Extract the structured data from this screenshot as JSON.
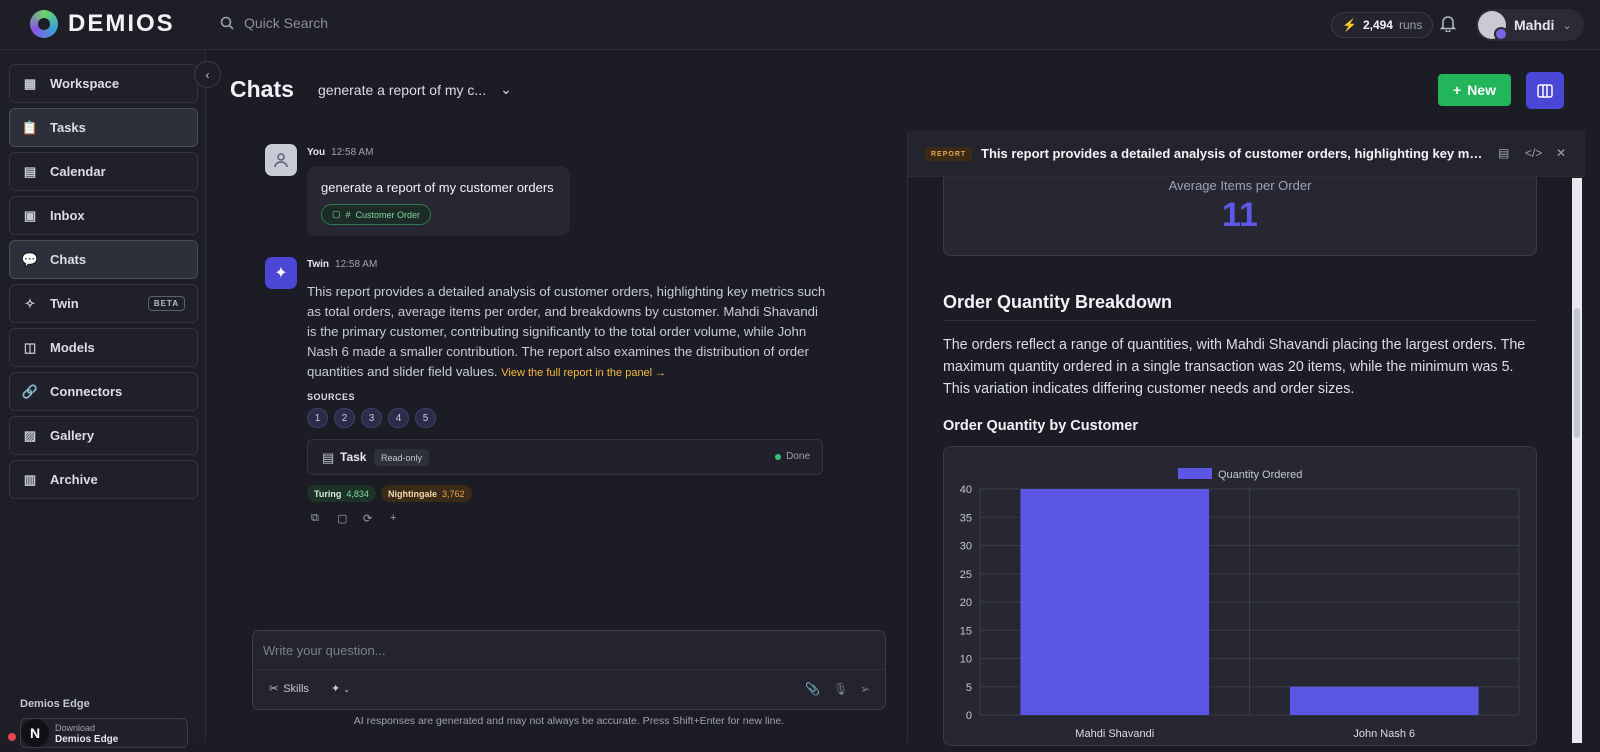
{
  "app": {
    "brand": "DEMIOS",
    "search_placeholder": "Quick Search",
    "runs_count": "2,494",
    "runs_label": "runs",
    "user_name": "Mahdi"
  },
  "sidebar": {
    "items": [
      {
        "label": "Workspace",
        "icon": "grid-icon"
      },
      {
        "label": "Tasks",
        "icon": "clipboard-icon"
      },
      {
        "label": "Calendar",
        "icon": "calendar-icon"
      },
      {
        "label": "Inbox",
        "icon": "inbox-icon"
      },
      {
        "label": "Chats",
        "icon": "chat-icon"
      },
      {
        "label": "Twin",
        "icon": "twin-icon",
        "badge": "BETA"
      },
      {
        "label": "Models",
        "icon": "cpu-icon"
      },
      {
        "label": "Connectors",
        "icon": "link-icon"
      },
      {
        "label": "Gallery",
        "icon": "image-icon"
      },
      {
        "label": "Archive",
        "icon": "archive-icon"
      }
    ],
    "edge_title": "Demios Edge",
    "edge_download": "Download",
    "edge_name": "Demios Edge"
  },
  "main": {
    "title": "Chats",
    "chat_select": "generate a report of my c...",
    "new_label": "New"
  },
  "messages": {
    "you": {
      "author": "You",
      "time": "12:58 AM",
      "text": "generate a report of my customer orders",
      "tag": "Customer Order"
    },
    "twin": {
      "author": "Twin",
      "time": "12:58 AM",
      "text": "This report provides a detailed analysis of customer orders, highlighting key metrics such as total orders, average items per order, and breakdowns by customer. Mahdi Shavandi is the primary customer, contributing significantly to the total order volume, while John Nash 6 made a smaller contribution. The report also examines the distribution of order quantities and slider field values.",
      "link": "View the full report in the panel →",
      "sources_label": "SOURCES",
      "sources": [
        "1",
        "2",
        "3",
        "4",
        "5"
      ],
      "task_label": "Task",
      "task_badge": "Read-only",
      "task_status": "Done",
      "turing_label": "Turing",
      "turing_value": "4,834",
      "nightingale_label": "Nightingale",
      "nightingale_value": "3,762"
    }
  },
  "composer": {
    "placeholder": "Write your question...",
    "skills_label": "Skills",
    "disclaimer": "AI responses are generated and may not always be accurate. Press Shift+Enter for new line."
  },
  "panel": {
    "badge": "REPORT",
    "title": "This report provides a detailed analysis of customer orders, highlighting key metrics such as total orders",
    "metric_label": "Average Items per Order",
    "metric_value": "11",
    "section_title": "Order Quantity Breakdown",
    "section_text": "The orders reflect a range of quantities, with Mahdi Shavandi placing the largest orders. The maximum quantity ordered in a single transaction was 20 items, while the minimum was 5. This variation indicates differing customer needs and order sizes.",
    "chart_title": "Order Quantity by Customer"
  },
  "colors": {
    "accent": "#4a46d6",
    "bar": "#5b56e4",
    "new_button": "#22b55a",
    "report_badge": "#e9a54a"
  },
  "chart_data": {
    "type": "bar",
    "title": "Order Quantity by Customer",
    "categories": [
      "Mahdi Shavandi",
      "John Nash 6"
    ],
    "series": [
      {
        "name": "Quantity Ordered",
        "values": [
          40,
          5
        ]
      }
    ],
    "ylim": [
      0,
      40
    ],
    "yticks": [
      0,
      5,
      10,
      15,
      20,
      25,
      30,
      35,
      40
    ],
    "legend": "top-center",
    "grid": true
  }
}
